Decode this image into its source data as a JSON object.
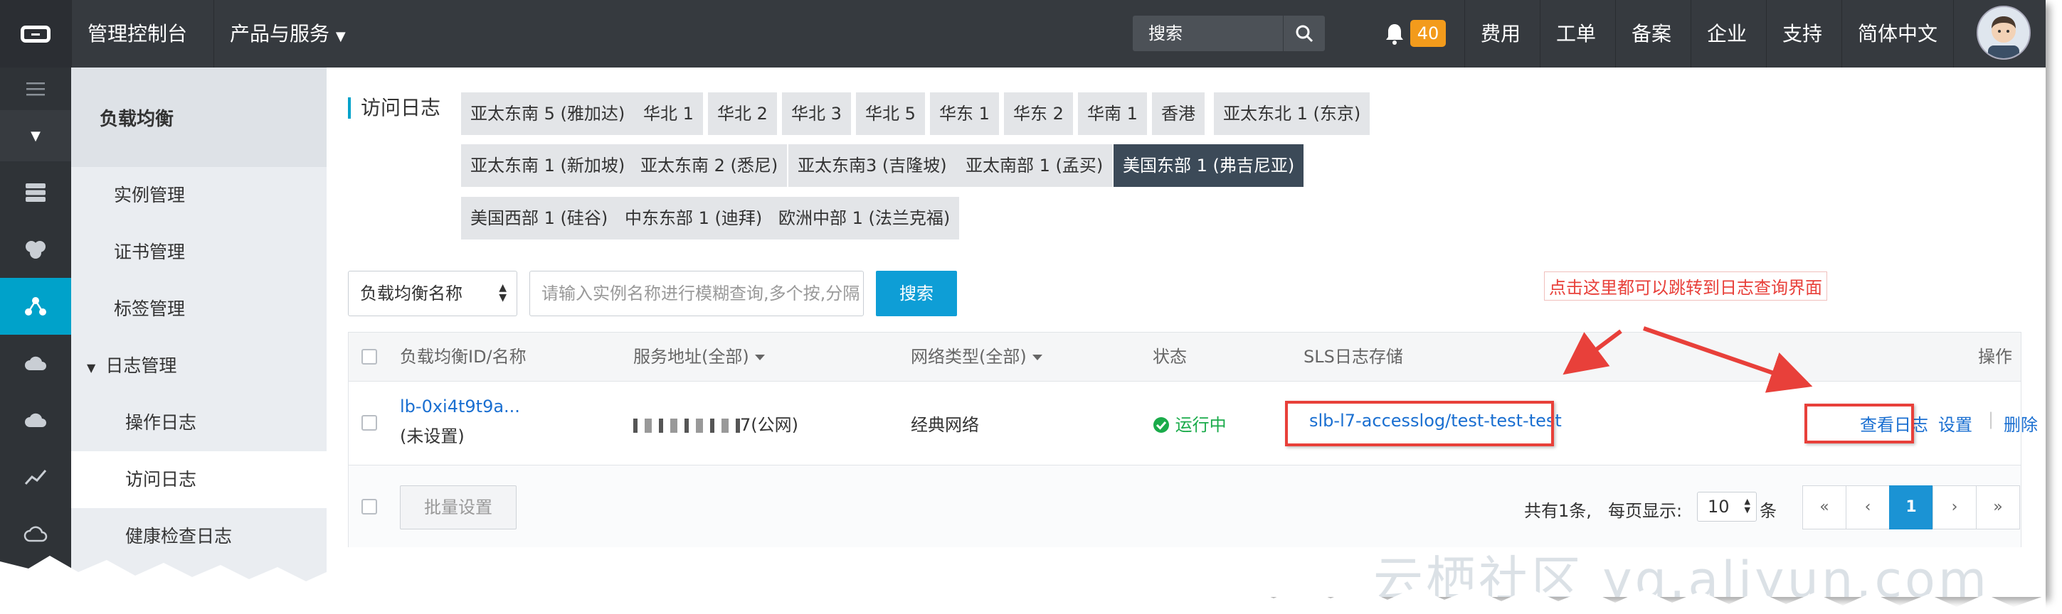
{
  "topbar": {
    "console_label": "管理控制台",
    "products_label": "产品与服务",
    "search_placeholder": "搜索",
    "notification_count": "40",
    "menu": [
      "费用",
      "工单",
      "备案",
      "企业",
      "支持",
      "简体中文"
    ]
  },
  "subnav": {
    "title": "负载均衡",
    "items": [
      "实例管理",
      "证书管理",
      "标签管理",
      "日志管理",
      "操作日志",
      "访问日志",
      "健康检查日志"
    ]
  },
  "main": {
    "section_title": "访问日志",
    "regions_row1": [
      "亚太东南 5 (雅加达)",
      "华北 1",
      "华北 2",
      "华北 3",
      "华北 5",
      "华东 1",
      "华东 2",
      "华南 1",
      "香港",
      "亚太东北 1 (东京)"
    ],
    "regions_row2": [
      "亚太东南 1 (新加坡)",
      "亚太东南 2 (悉尼)",
      "亚太东南3 (吉隆坡)",
      "亚太南部 1 (孟买)",
      "美国东部 1 (弗吉尼亚)"
    ],
    "regions_row3": [
      "美国西部 1 (硅谷)",
      "中东东部 1 (迪拜)",
      "欧洲中部 1 (法兰克福)"
    ],
    "filter_select": "负载均衡名称",
    "search_input_placeholder": "请输入实例名称进行模糊查询,多个按,分隔",
    "search_button": "搜索"
  },
  "table": {
    "headers": {
      "id_name": "负载均衡ID/名称",
      "address": "服务地址(全部)",
      "network": "网络类型(全部)",
      "status": "状态",
      "sls": "SLS日志存储",
      "actions": "操作"
    },
    "rows": [
      {
        "id": "lb-0xi4t9t9a...",
        "name": "(未设置)",
        "address_suffix": "7(公网)",
        "network": "经典网络",
        "status": "运行中",
        "sls": "slb-l7-accesslog/test-test-test",
        "actions": [
          "查看日志",
          "设置",
          "删除"
        ]
      }
    ],
    "batch_button": "批量设置",
    "total_text": "共有1条,",
    "page_size_label": "每页显示:",
    "page_size": "10",
    "page_size_suffix": "条",
    "pagination": [
      "«",
      "‹",
      "1",
      "›",
      "»"
    ]
  },
  "annotation": {
    "note": "点击这里都可以跳转到日志查询界面"
  },
  "watermark": "云栖社区 yq.aliyun.com",
  "colors": {
    "topbar": "#363a3f",
    "accent": "#00a2ca",
    "primary_button": "#0e9ed6",
    "annotation_red": "#e8403a",
    "status_green": "#1aab4a"
  }
}
